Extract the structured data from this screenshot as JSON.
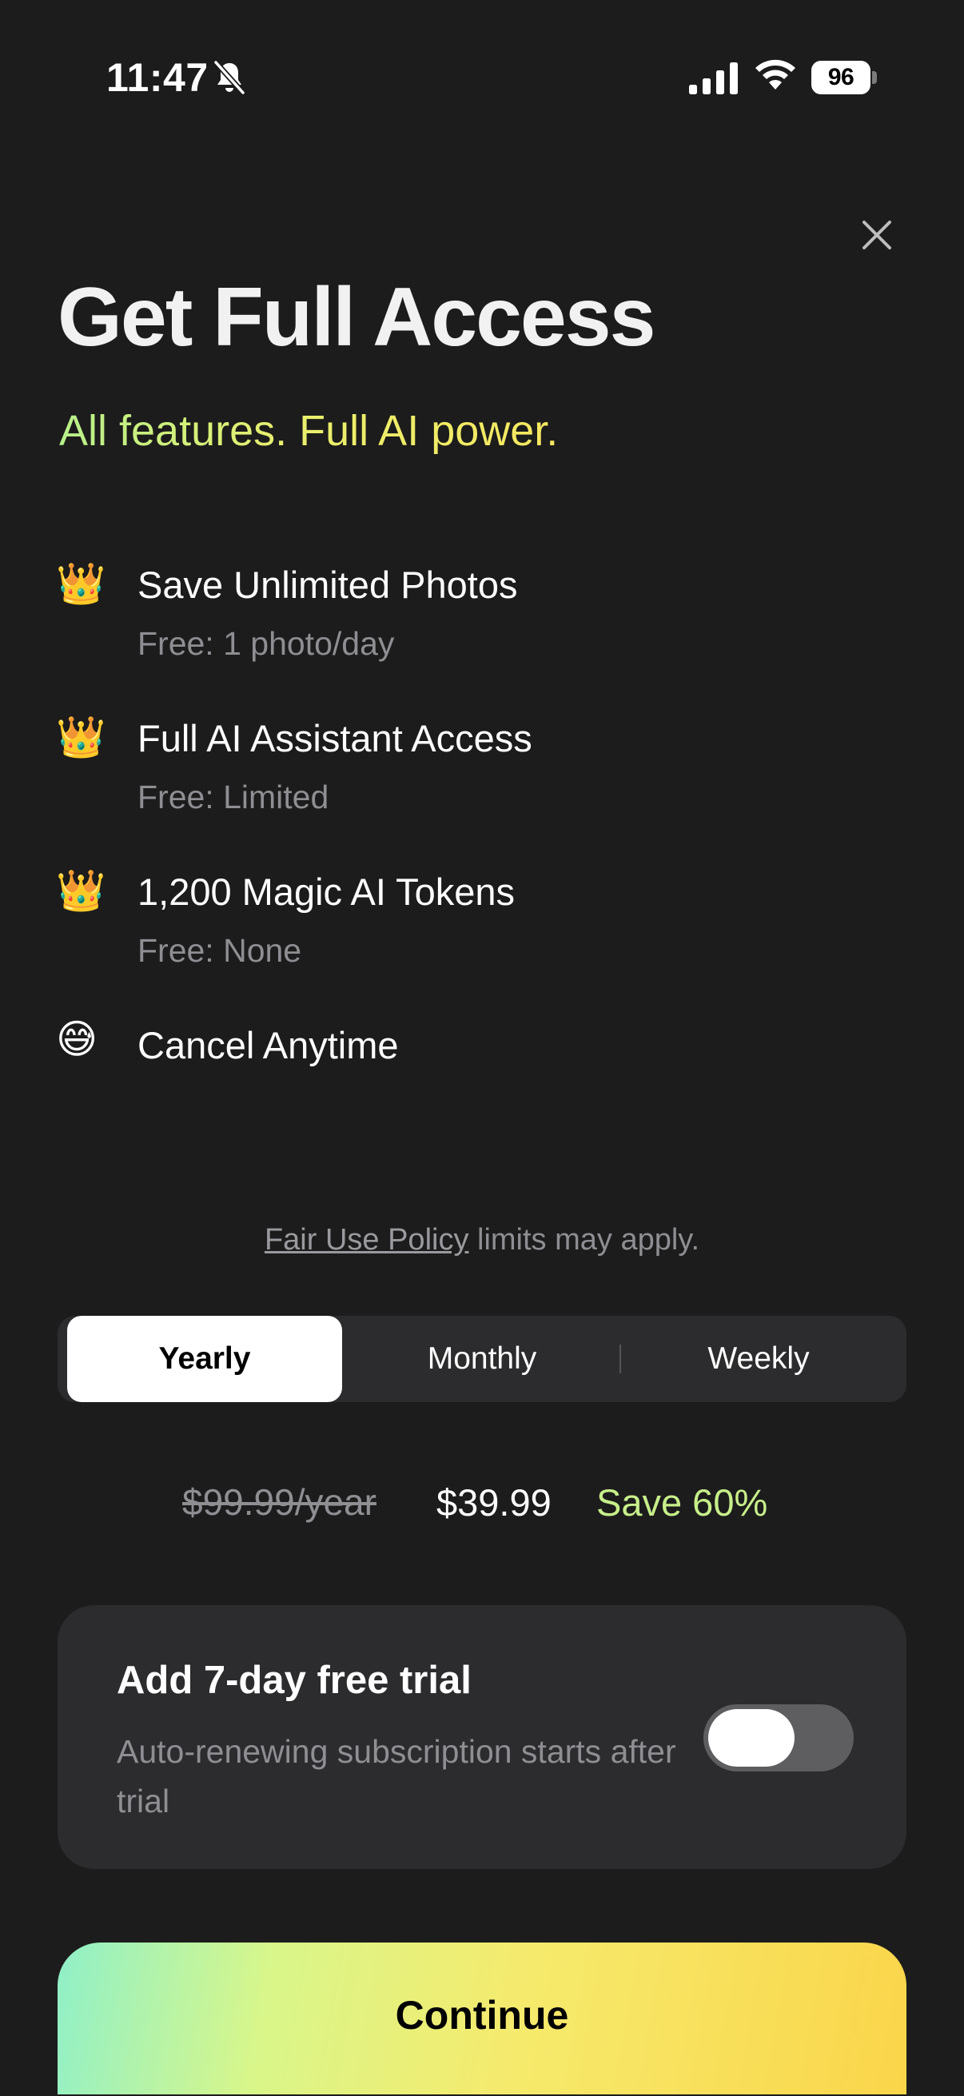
{
  "status_bar": {
    "time": "11:47",
    "battery": "96",
    "icons": [
      "bell-slash-icon",
      "cellular-signal-icon",
      "wifi-icon",
      "battery-icon"
    ]
  },
  "header": {
    "close_icon": "close-icon",
    "title": "Get Full Access",
    "subtitle": "All features. Full AI power."
  },
  "features": [
    {
      "icon": "crown-icon",
      "emoji": "👑",
      "title": "Save Unlimited Photos",
      "subtitle": "Free: 1 photo/day"
    },
    {
      "icon": "crown-icon",
      "emoji": "👑",
      "title": "Full AI Assistant Access",
      "subtitle": "Free: Limited"
    },
    {
      "icon": "crown-icon",
      "emoji": "👑",
      "title": "1,200 Magic AI Tokens",
      "subtitle": "Free: None"
    },
    {
      "icon": "grinning-sweat-face-icon",
      "emoji": "😅",
      "title": "Cancel Anytime",
      "subtitle": ""
    }
  ],
  "fair_use": {
    "link": "Fair Use Policy",
    "text": " limits may apply."
  },
  "plans": {
    "options": [
      "Yearly",
      "Monthly",
      "Weekly"
    ],
    "selected": "Yearly"
  },
  "pricing": {
    "old_price": "$99.99/year",
    "new_price": "$39.99",
    "save": "Save 60%"
  },
  "trial": {
    "title": "Add 7-day free trial",
    "description": "Auto-renewing subscription starts after trial",
    "enabled": false
  },
  "cta": {
    "label": "Continue"
  },
  "colors": {
    "background": "#1c1c1c",
    "card": "#2c2c2e",
    "accent_green": "#c7ef8a",
    "muted_text": "#8e8e93"
  }
}
